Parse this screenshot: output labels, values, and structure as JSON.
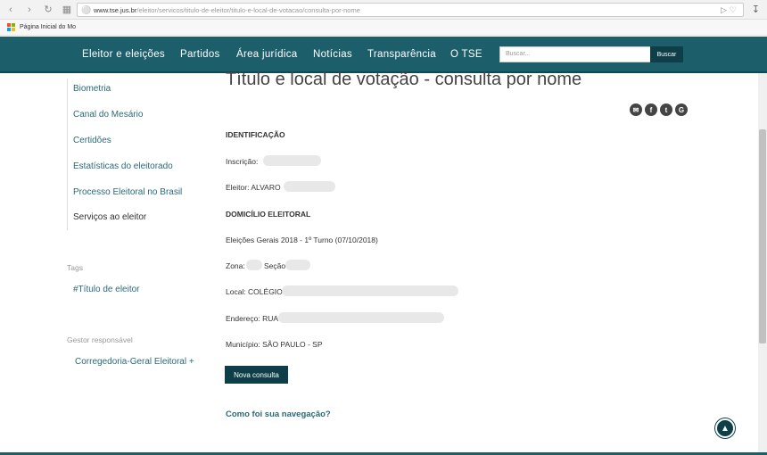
{
  "browser": {
    "host": "www.tse.jus.br",
    "path": "/eleitor/servicos/titulo-de-eleitor/titulo-e-local-de-votacao/consulta-por-nome",
    "bookmark": "Página Inicial do Mo"
  },
  "nav": {
    "items": [
      "Eleitor e eleições",
      "Partidos",
      "Área jurídica",
      "Notícias",
      "Transparência",
      "O TSE"
    ],
    "search_placeholder": "Buscar...",
    "search_button": "Buscar"
  },
  "sidebar": {
    "links": [
      "Biometria",
      "Canal do Mesário",
      "Certidões",
      "Estatísticas do eleitorado",
      "Processo Eleitoral no Brasil",
      "Serviços ao eleitor"
    ],
    "tags_label": "Tags",
    "tag": "#Título de eleitor",
    "manager_label": "Gestor responsável",
    "manager": "Corregedoria-Geral Eleitoral +"
  },
  "main": {
    "title": "Título e local de votação - consulta por nome",
    "identification": "IDENTIFICAÇÃO",
    "inscricao": "Inscrição:",
    "eleitor": "Eleitor: ALVARO",
    "domicilio": "DOMICÍLIO ELEITORAL",
    "eleicoes": "Eleições Gerais 2018 - 1º Turno (07/10/2018)",
    "zona": "Zona:",
    "secao": "Seção",
    "local": "Local: COLÉGIO",
    "endereco": "Endereço: RUA",
    "municipio": "Município: SÃO PAULO - SP",
    "new_button": "Nova consulta",
    "feedback": "Como foi sua navegação?"
  },
  "colors": {
    "nav_bg": "#1c5f6b",
    "button_bg": "#0e3f49",
    "link": "#2a6a77"
  }
}
